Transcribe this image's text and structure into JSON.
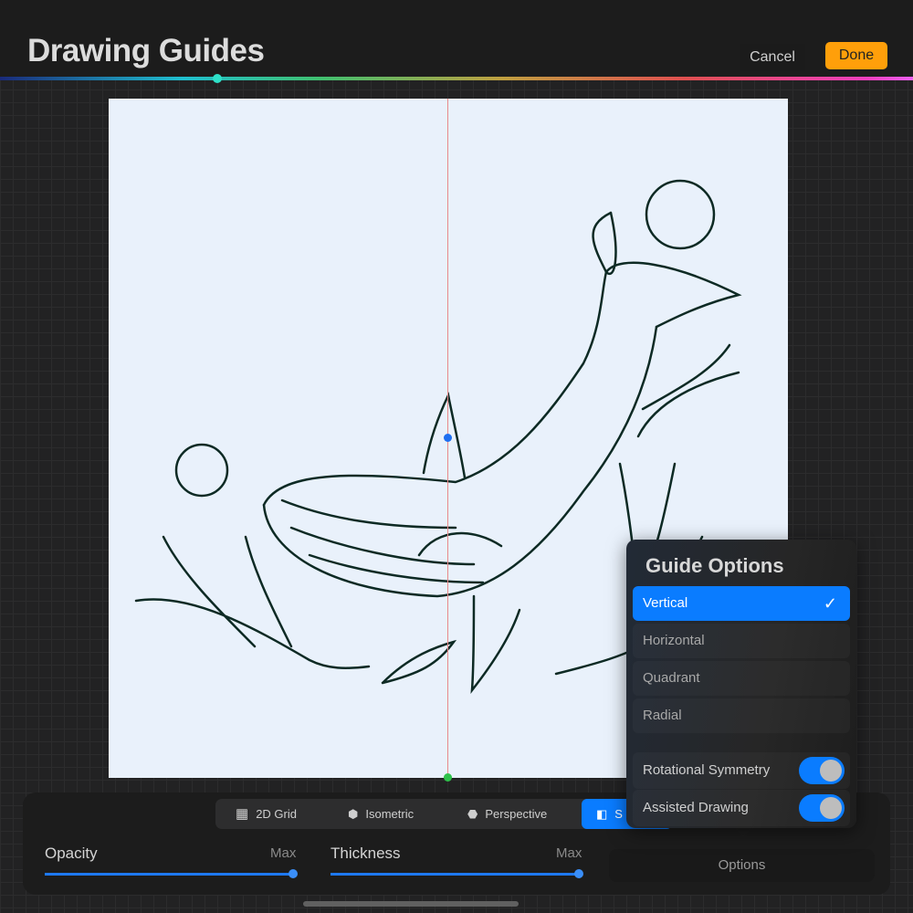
{
  "header": {
    "title": "Drawing Guides",
    "cancel_label": "Cancel",
    "done_label": "Done"
  },
  "colors": {
    "accent": "#0a7cff",
    "done": "#ff9f0a",
    "canvas": "#e9f1fb",
    "axis": "#e88a8a",
    "ink": "#0d2a24"
  },
  "guide_tabs": [
    {
      "label": "2D Grid",
      "icon": "grid-icon"
    },
    {
      "label": "Isometric",
      "icon": "isometric-icon"
    },
    {
      "label": "Perspective",
      "icon": "perspective-icon"
    },
    {
      "label": "S",
      "icon": "symmetry-icon",
      "active": true
    }
  ],
  "sliders": {
    "opacity": {
      "label": "Opacity",
      "max_label": "Max",
      "value": 1.0
    },
    "thickness": {
      "label": "Thickness",
      "max_label": "Max",
      "value": 1.0
    }
  },
  "options_button": "Options",
  "guide_options": {
    "title": "Guide Options",
    "items": [
      {
        "label": "Vertical",
        "selected": true
      },
      {
        "label": "Horizontal",
        "selected": false
      },
      {
        "label": "Quadrant",
        "selected": false
      },
      {
        "label": "Radial",
        "selected": false
      }
    ],
    "checkmark": "✓",
    "toggles": [
      {
        "label": "Rotational Symmetry",
        "on": true
      },
      {
        "label": "Assisted Drawing",
        "on": true
      }
    ]
  }
}
